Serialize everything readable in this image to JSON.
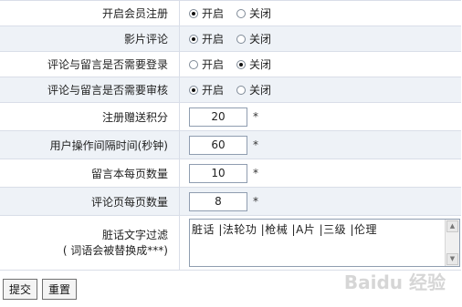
{
  "settings": {
    "member_registration": {
      "label": "开启会员注册",
      "options": [
        {
          "label": "开启",
          "checked": true
        },
        {
          "label": "关闭",
          "checked": false
        }
      ]
    },
    "movie_comments": {
      "label": "影片评论",
      "options": [
        {
          "label": "开启",
          "checked": true
        },
        {
          "label": "关闭",
          "checked": false
        }
      ]
    },
    "comment_login_required": {
      "label": "评论与留言是否需要登录",
      "options": [
        {
          "label": "开启",
          "checked": false
        },
        {
          "label": "关闭",
          "checked": true
        }
      ]
    },
    "comment_review_required": {
      "label": "评论与留言是否需要审核",
      "options": [
        {
          "label": "开启",
          "checked": true
        },
        {
          "label": "关闭",
          "checked": false
        }
      ]
    },
    "registration_points": {
      "label": "注册赠送积分",
      "value": "20",
      "required_mark": "*"
    },
    "operation_interval": {
      "label": "用户操作间隔时间(秒钟)",
      "value": "60",
      "required_mark": "*"
    },
    "guestbook_page_size": {
      "label": "留言本每页数量",
      "value": "10",
      "required_mark": "*"
    },
    "comment_page_size": {
      "label": "评论页每页数量",
      "value": "8",
      "required_mark": "*"
    },
    "word_filter": {
      "label": "脏话文字过滤",
      "hint": "( 词语会被替换成***)",
      "value": "脏话 |法轮功 |枪械 |A片 |三级 |伦理"
    }
  },
  "buttons": {
    "submit_label": "提交",
    "reset_label": "重置"
  },
  "watermark": "Baidu 经验"
}
